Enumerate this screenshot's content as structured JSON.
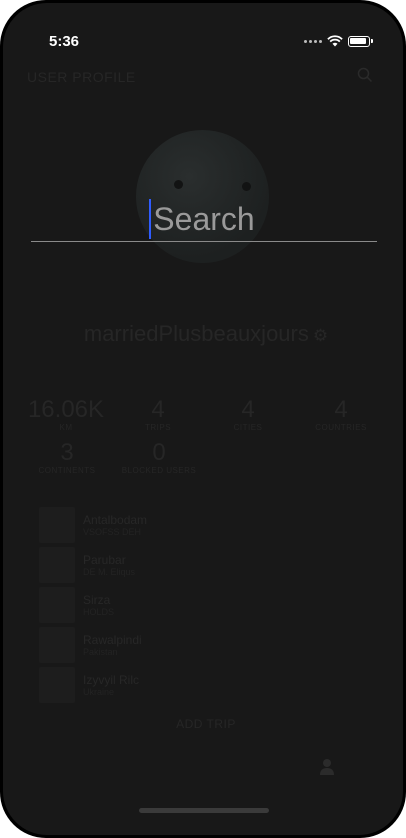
{
  "status_bar": {
    "time": "5:36"
  },
  "header": {
    "title": "USER PROFILE",
    "search_icon": "search-icon"
  },
  "search": {
    "value": "",
    "placeholder": "Search"
  },
  "profile": {
    "username": "marriedPlusbeauxjours",
    "settings_icon": "gear-icon"
  },
  "stats": [
    {
      "value": "16.06K",
      "label": "KM"
    },
    {
      "value": "4",
      "label": "TRIPS"
    },
    {
      "value": "4",
      "label": "CITIES"
    },
    {
      "value": "4",
      "label": "COUNTRIES"
    },
    {
      "value": "3",
      "label": "CONTINENTS"
    },
    {
      "value": "0",
      "label": "BLOCKED USERS"
    }
  ],
  "trips": [
    {
      "name": "Antalbodam",
      "sub": "VSOFSS DEH"
    },
    {
      "name": "Parubar",
      "sub": "DE M. Eliqus"
    },
    {
      "name": "Sirza",
      "sub": "HOLDS"
    },
    {
      "name": "Rawalpindi",
      "sub": "Pakistan"
    },
    {
      "name": "Izyvyil Rilc",
      "sub": "Ukraine"
    }
  ],
  "actions": {
    "add_trip": "ADD TRIP"
  },
  "tab_bar": {
    "profile_icon": "user-icon"
  },
  "colors": {
    "background": "#181818",
    "caret": "#2f5cff"
  }
}
